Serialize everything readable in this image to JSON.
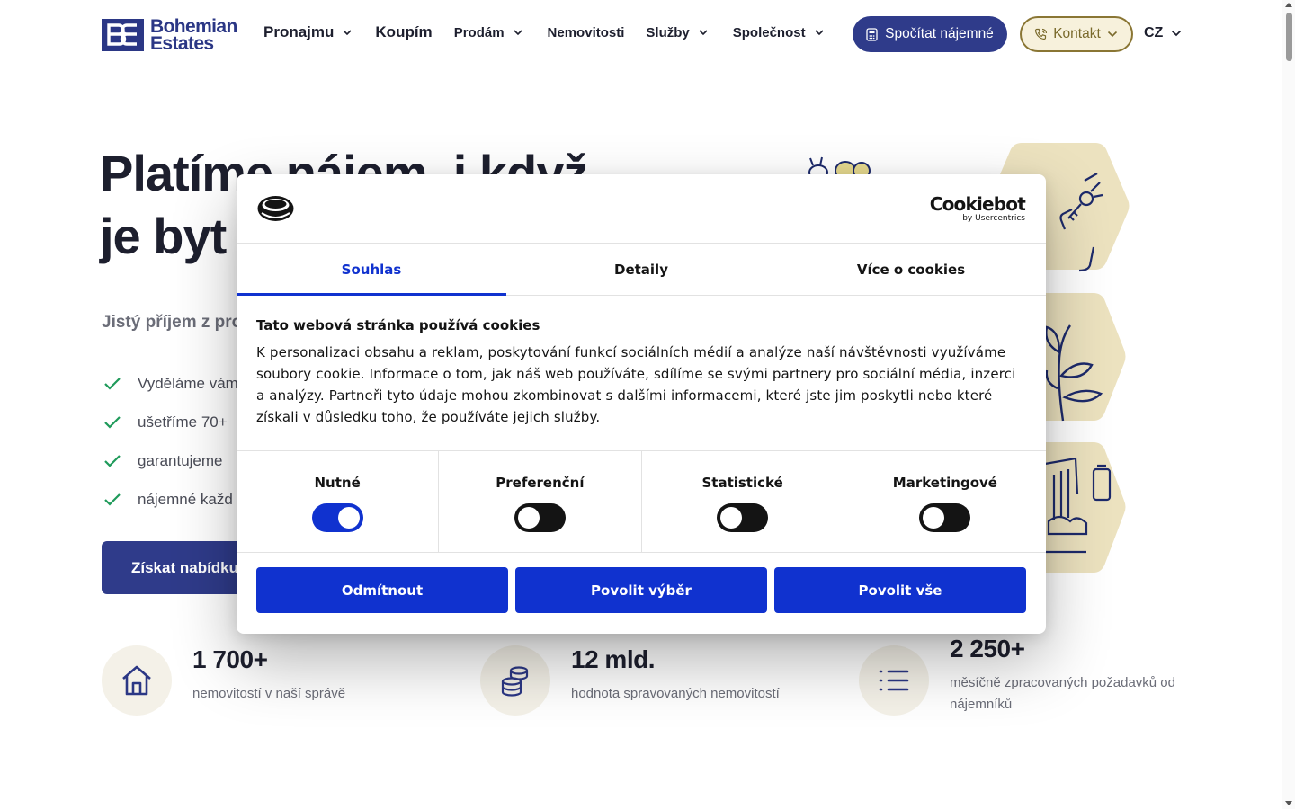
{
  "header": {
    "logo_line1": "Bohemian",
    "logo_line2": "Estates",
    "nav": [
      {
        "label": "Pronajmu",
        "has_dropdown": true
      },
      {
        "label": "Koupím",
        "has_dropdown": false
      },
      {
        "label": "Prodám",
        "has_dropdown": true
      },
      {
        "label": "Nemovitosti",
        "has_dropdown": false
      },
      {
        "label": "Služby",
        "has_dropdown": true
      },
      {
        "label": "Společnost",
        "has_dropdown": true
      }
    ],
    "calc_button": "Spočítat nájemné",
    "contact_button": "Kontakt",
    "language": "CZ"
  },
  "hero": {
    "title_line1": "Platíme nájem, i když",
    "title_line2": "je byt",
    "subtitle": "Jistý příjem z pron",
    "checks": [
      "Vyděláme vám",
      "ušetříme 70+",
      "garantujeme",
      "nájemné každ"
    ],
    "cta": "Získat nabídku"
  },
  "stats": [
    {
      "value": "1 700+",
      "desc": "nemovitostí v naší správě",
      "icon": "house-icon"
    },
    {
      "value": "12 mld.",
      "desc": "hodnota spravovaných nemovitostí",
      "icon": "coins-icon"
    },
    {
      "value": "2 250+",
      "desc": "měsíčně zpracovaných požadavků od nájemníků",
      "icon": "list-icon"
    }
  ],
  "cookie_dialog": {
    "brand_name": "Cookiebot",
    "brand_sub": "by Usercentrics",
    "tabs": [
      "Souhlas",
      "Detaily",
      "Více o cookies"
    ],
    "active_tab": "Souhlas",
    "title": "Tato webová stránka používá cookies",
    "text": "K personalizaci obsahu a reklam, poskytování funkcí sociálních médií a analýze naší návštěvnosti využíváme soubory cookie. Informace o tom, jak náš web používáte, sdílíme se svými partnery pro sociální média, inzerci a analýzy. Partneři tyto údaje mohou zkombinovat s dalšími informacemi, které jste jim poskytli nebo které získali v důsledku toho, že používáte jejich služby.",
    "toggles": [
      {
        "label": "Nutné",
        "on": true
      },
      {
        "label": "Preferenční",
        "on": false
      },
      {
        "label": "Statistické",
        "on": false
      },
      {
        "label": "Marketingové",
        "on": false
      }
    ],
    "buttons": [
      "Odmítnout",
      "Povolit výběr",
      "Povolit vše"
    ]
  },
  "colors": {
    "brand_blue": "#2f3b8a",
    "cookie_blue": "#1032cf",
    "check_green": "#1f9a5a",
    "contact_gold": "#8a7634",
    "hex_beige": "#ece2bf"
  }
}
